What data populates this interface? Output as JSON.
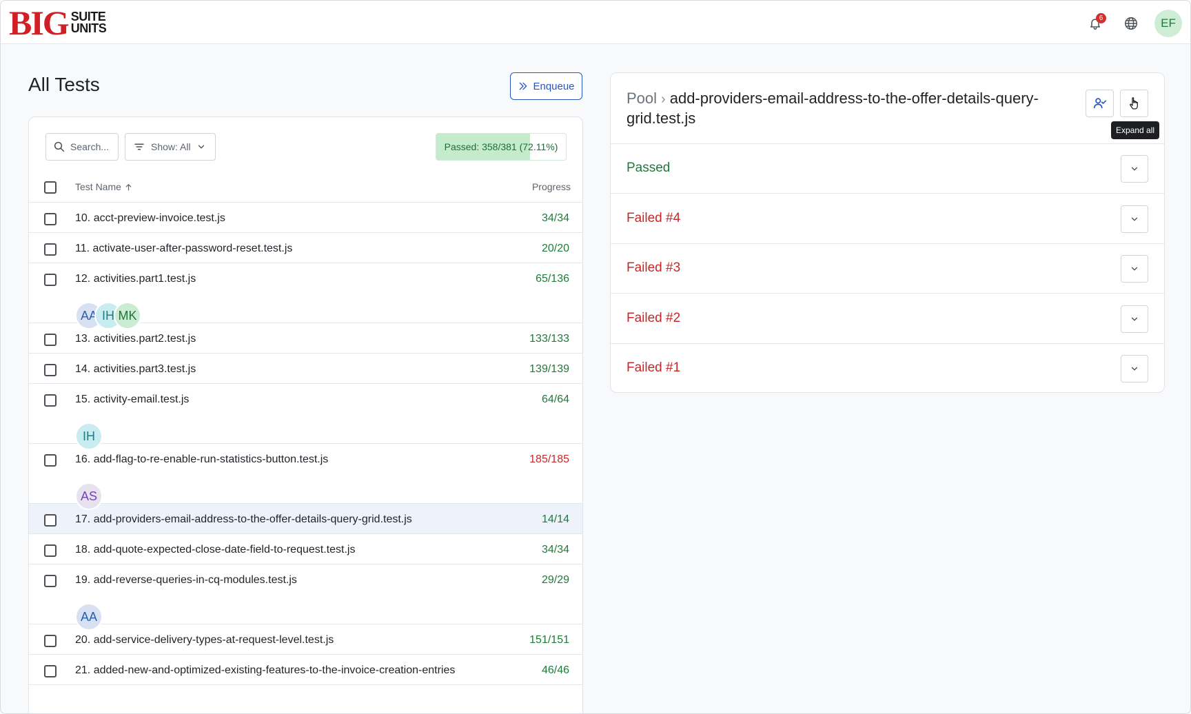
{
  "header": {
    "logo_big": "BIG",
    "logo_line1": "SUITE",
    "logo_line2": "UNITS",
    "notification_count": "6",
    "user_initials": "EF"
  },
  "left": {
    "title": "All Tests",
    "enqueue_label": "Enqueue",
    "search_placeholder": "Search...",
    "filter_label": "Show: All",
    "summary_label": "Passed: 358/381 (72.11%)",
    "summary_fraction": 0.7211,
    "col_name": "Test Name",
    "col_progress": "Progress",
    "rows": [
      {
        "name": "10. acct-preview-invoice.test.js",
        "progress": "34/34",
        "status": "green",
        "avatars": []
      },
      {
        "name": "11. activate-user-after-password-reset.test.js",
        "progress": "20/20",
        "status": "green",
        "avatars": []
      },
      {
        "name": "12. activities.part1.test.js",
        "progress": "65/136",
        "status": "green",
        "avatars": [
          {
            "initials": "AA",
            "color": "blue"
          },
          {
            "initials": "IH",
            "color": "teal"
          },
          {
            "initials": "MK",
            "color": "green"
          }
        ]
      },
      {
        "name": "13. activities.part2.test.js",
        "progress": "133/133",
        "status": "green",
        "avatars": []
      },
      {
        "name": "14. activities.part3.test.js",
        "progress": "139/139",
        "status": "green",
        "avatars": []
      },
      {
        "name": "15. activity-email.test.js",
        "progress": "64/64",
        "status": "green",
        "avatars": [
          {
            "initials": "IH",
            "color": "teal"
          }
        ]
      },
      {
        "name": "16. add-flag-to-re-enable-run-statistics-button.test.js",
        "progress": "185/185",
        "status": "red",
        "avatars": [
          {
            "initials": "AS",
            "color": "purple"
          }
        ]
      },
      {
        "name": "17. add-providers-email-address-to-the-offer-details-query-grid.test.js",
        "progress": "14/14",
        "status": "green",
        "avatars": [],
        "selected": true
      },
      {
        "name": "18. add-quote-expected-close-date-field-to-request.test.js",
        "progress": "34/34",
        "status": "green",
        "avatars": []
      },
      {
        "name": "19. add-reverse-queries-in-cq-modules.test.js",
        "progress": "29/29",
        "status": "green",
        "avatars": [
          {
            "initials": "AA",
            "color": "blue"
          }
        ]
      },
      {
        "name": "20. add-service-delivery-types-at-request-level.test.js",
        "progress": "151/151",
        "status": "green",
        "avatars": []
      },
      {
        "name": "21. added-new-and-optimized-existing-features-to-the-invoice-creation-entries",
        "progress": "46/46",
        "status": "green",
        "avatars": []
      }
    ]
  },
  "right": {
    "breadcrumb_root": "Pool",
    "breadcrumb_current": "add-providers-email-address-to-the-offer-details-query-grid.test.js",
    "tooltip": "Expand all",
    "attempts": [
      {
        "label": "Passed",
        "status": "pass"
      },
      {
        "label": "Failed #4",
        "status": "fail"
      },
      {
        "label": "Failed #3",
        "status": "fail"
      },
      {
        "label": "Failed #2",
        "status": "fail"
      },
      {
        "label": "Failed #1",
        "status": "fail"
      }
    ]
  },
  "colors": {
    "brand_red": "#d21f26",
    "accent_blue": "#2456c2",
    "pass_green": "#1f7a39",
    "fail_red": "#c62828"
  }
}
